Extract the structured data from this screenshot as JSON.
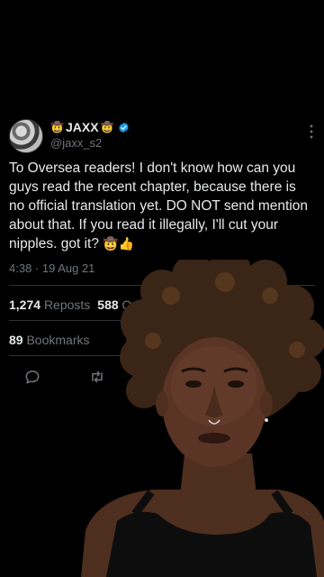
{
  "tweet": {
    "display_name": "JAXX",
    "name_emoji_left": "🤠",
    "name_emoji_right": "🤠",
    "handle": "@jaxx_s2",
    "text": "To Oversea readers! I don't know how can you guys read the recent chapter, because there is no official translation yet. DO NOT send mention about that. If you read it illegally, I'll cut your nipples. got it?",
    "text_emoji": "🤠👍",
    "time": "4:38 · 19 Aug 21",
    "reposts_count": "1,274",
    "reposts_label": "Reposts",
    "quotes_count": "588",
    "quotes_label": "Quotes",
    "bookmarks_count": "89",
    "bookmarks_label": "Bookmarks"
  },
  "icons": {
    "verified": "verified-badge-icon",
    "more": "more-vertical-icon",
    "reply": "reply-icon",
    "repost": "repost-icon"
  },
  "colors": {
    "background": "#000000",
    "text_primary": "#e7e9ea",
    "text_secondary": "#71767b",
    "verified_blue": "#1d9bf0",
    "divider": "#2f3336"
  }
}
